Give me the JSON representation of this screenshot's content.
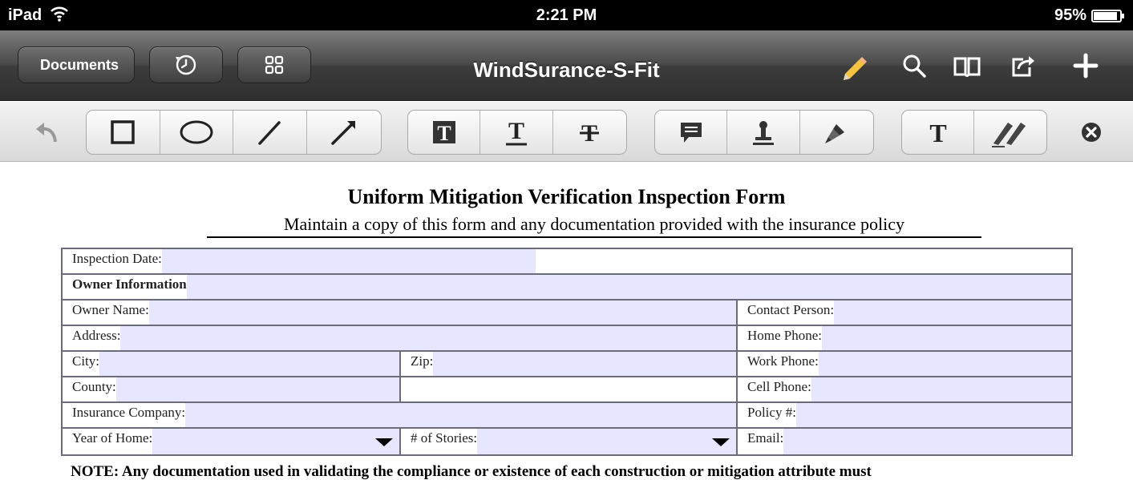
{
  "status": {
    "device": "iPad",
    "time": "2:21 PM",
    "battery": "95%",
    "battery_level": 0.95
  },
  "navbar": {
    "back_label": "Documents",
    "title": "WindSurance-S-Fit",
    "left_icons": [
      "clock-icon",
      "grid-icon"
    ],
    "right_icons": [
      "pencil-icon",
      "search-icon",
      "bookmarks-icon",
      "share-icon",
      "add-icon"
    ],
    "pencil_color": "#f5c242"
  },
  "toolbar": {
    "groups": [
      [
        "rectangle-tool-icon",
        "ellipse-tool-icon",
        "line-tool-icon",
        "arrow-tool-icon"
      ],
      [
        "text-highlight-tool-icon",
        "text-underline-tool-icon",
        "text-strikeout-tool-icon"
      ],
      [
        "note-tool-icon",
        "stamp-tool-icon",
        "pen-tool-icon"
      ],
      [
        "typewriter-tool-icon",
        "signature-tool-icon"
      ]
    ]
  },
  "document": {
    "title": "Uniform Mitigation Verification Inspection Form",
    "subtitle": "Maintain a copy of this form and any documentation provided with the insurance policy",
    "field_color": "#e6e6ff",
    "labels": {
      "inspection_date": "Inspection Date:",
      "owner_information": "Owner Information",
      "owner_name": "Owner Name:",
      "contact_person": "Contact Person:",
      "address": "Address:",
      "home_phone": "Home Phone:",
      "city": "City:",
      "zip": "Zip:",
      "work_phone": "Work Phone:",
      "county": "County:",
      "cell_phone": "Cell Phone:",
      "insurance_company": "Insurance Company:",
      "policy": "Policy #:",
      "year_of_home": "Year of Home:",
      "stories": "# of Stories:",
      "email": "Email:"
    },
    "note": "NOTE:  Any documentation used in validating the compliance or existence of each construction or mitigation attribute must"
  }
}
